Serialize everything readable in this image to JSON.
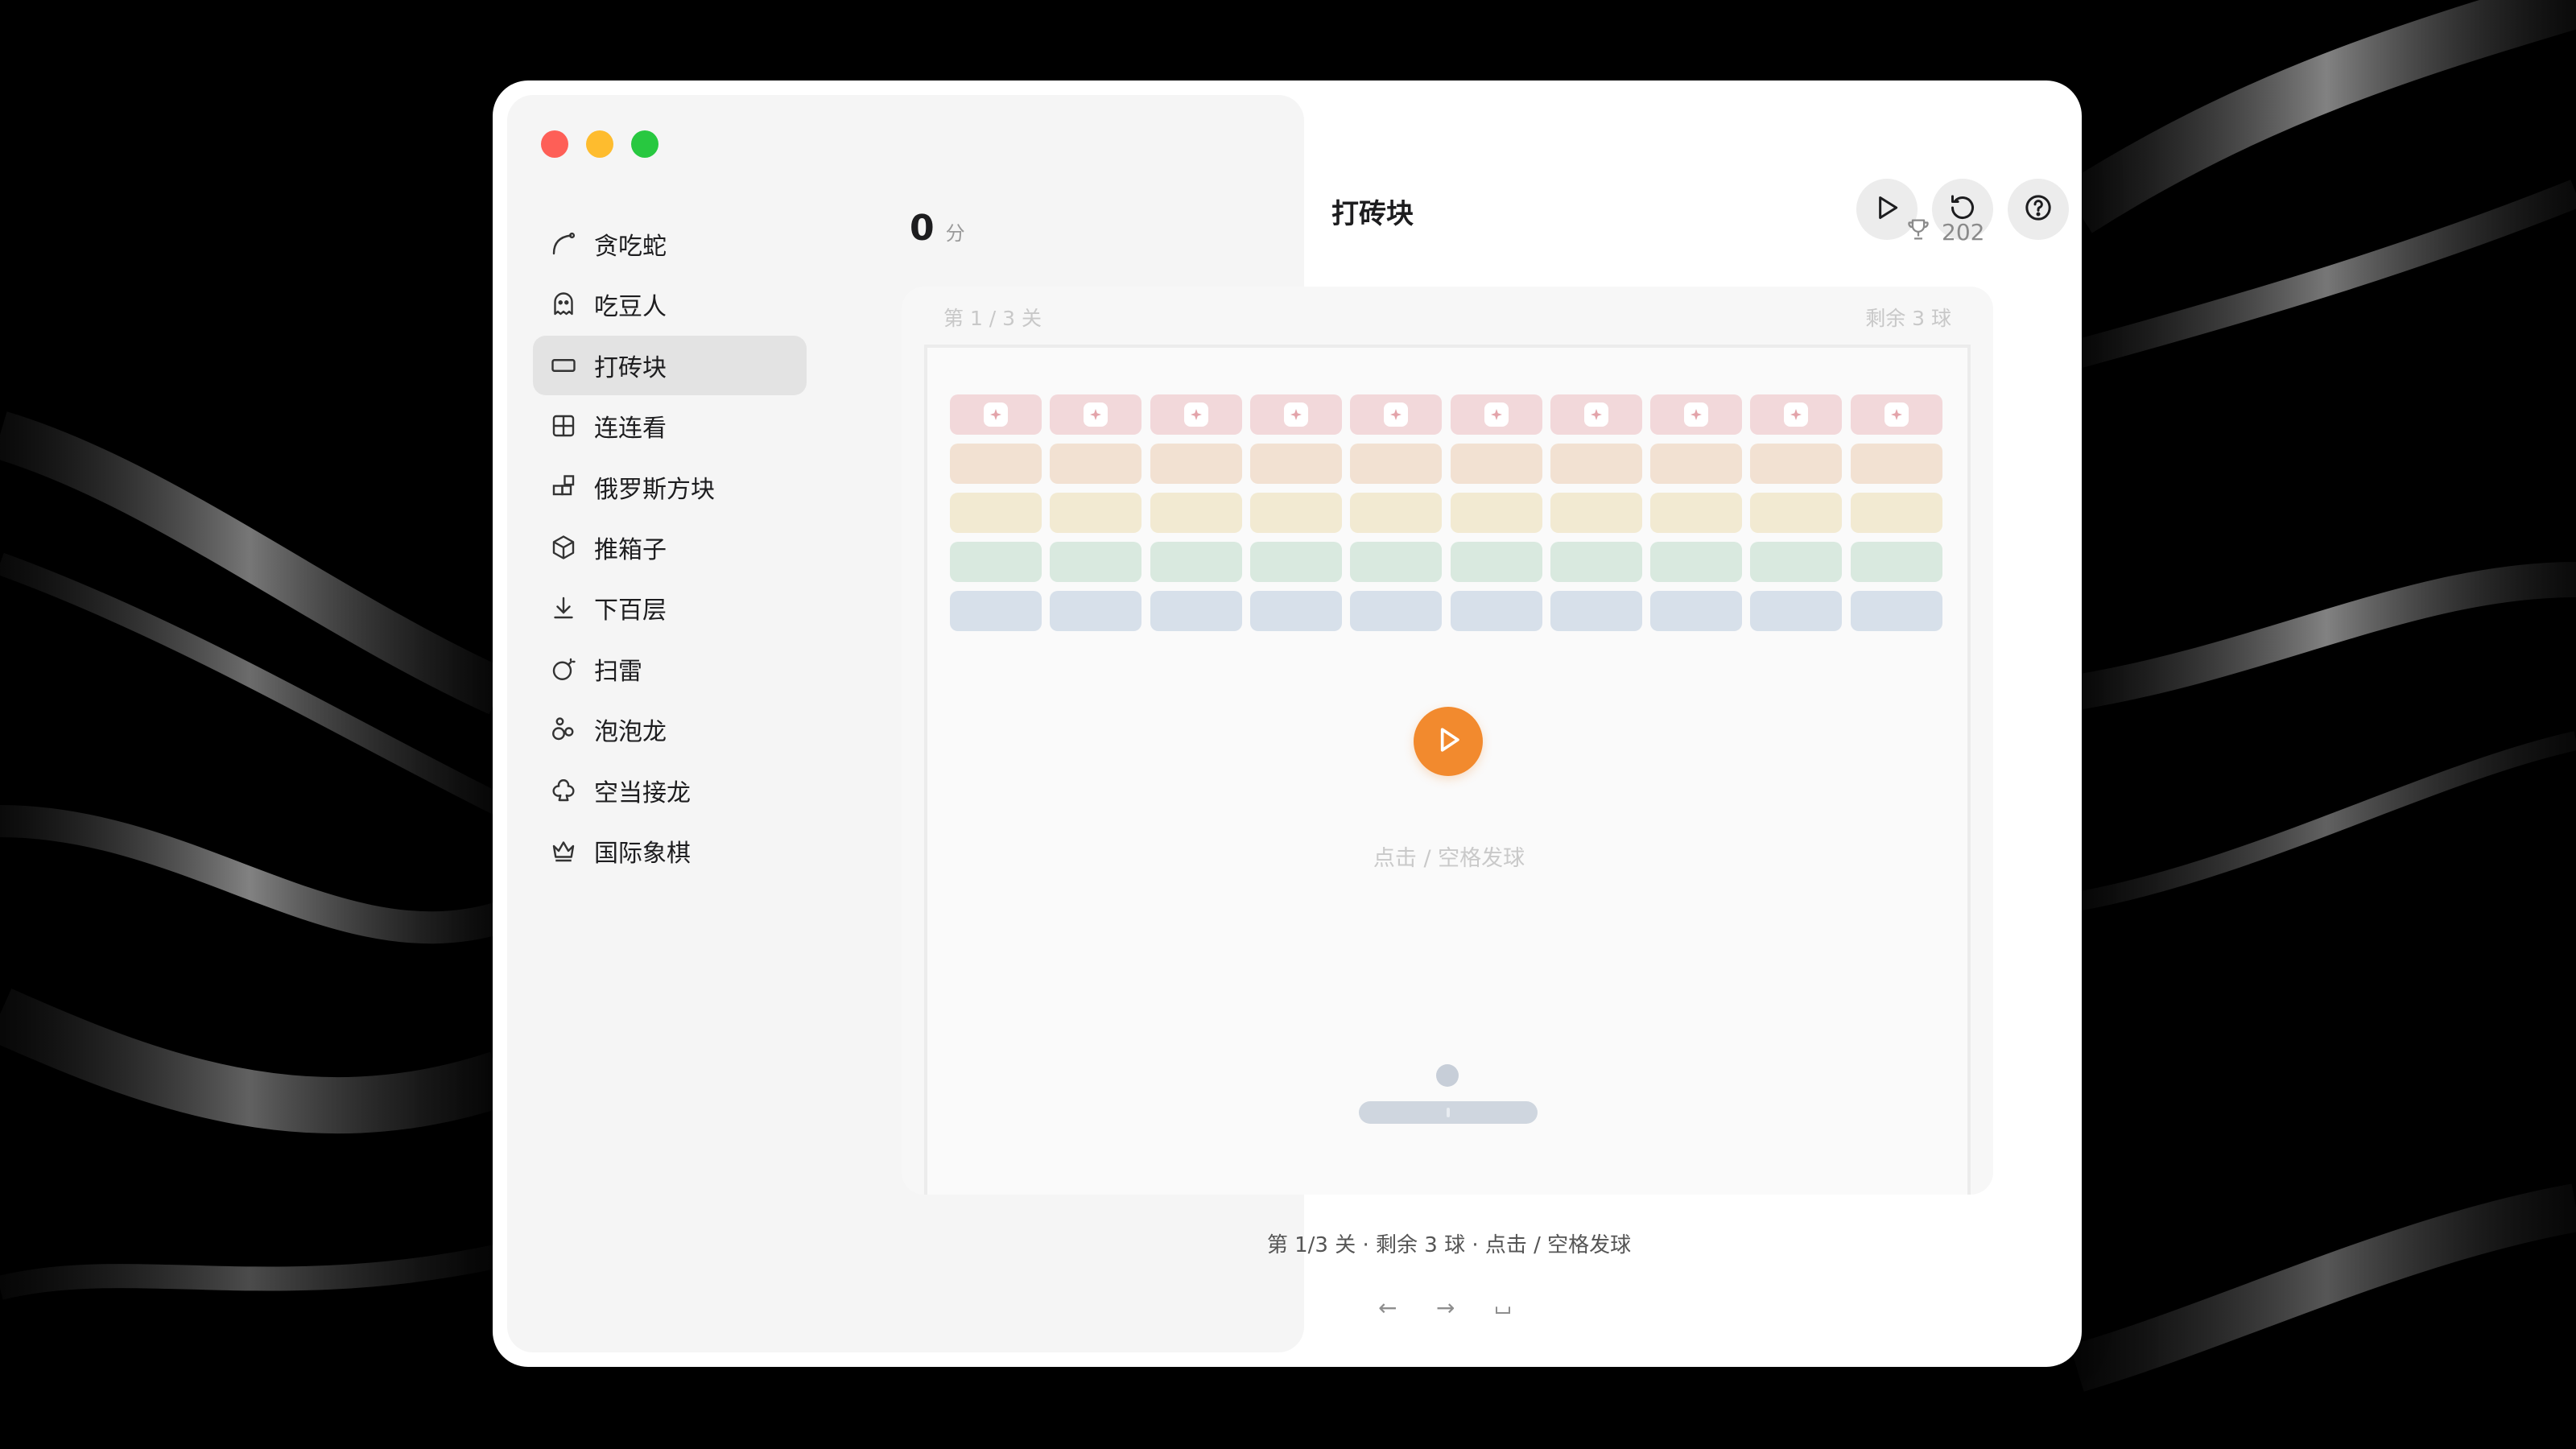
{
  "window": {
    "title": "打砖块"
  },
  "sidebar": {
    "items": [
      {
        "label": "贪吃蛇",
        "icon": "snake-curve-icon"
      },
      {
        "label": "吃豆人",
        "icon": "ghost-icon"
      },
      {
        "label": "打砖块",
        "icon": "brick-rect-icon",
        "active": true
      },
      {
        "label": "连连看",
        "icon": "grid-icon"
      },
      {
        "label": "俄罗斯方块",
        "icon": "blocks-icon"
      },
      {
        "label": "推箱子",
        "icon": "box-icon"
      },
      {
        "label": "下百层",
        "icon": "arrow-down-icon"
      },
      {
        "label": "扫雷",
        "icon": "bomb-icon"
      },
      {
        "label": "泡泡龙",
        "icon": "bubbles-icon"
      },
      {
        "label": "空当接龙",
        "icon": "club-icon"
      },
      {
        "label": "国际象棋",
        "icon": "crown-icon"
      }
    ]
  },
  "toolbar": {
    "play_icon": "play-icon",
    "restart_icon": "restart-icon",
    "help_icon": "help-icon"
  },
  "score": {
    "value": "0",
    "unit": "分",
    "best": "202",
    "best_icon": "trophy-icon"
  },
  "board": {
    "level_label": "第 1 / 3 关",
    "balls_label": "剩余 3 球",
    "hint": "点击 / 空格发球",
    "brick_columns": 10,
    "brick_rows": [
      {
        "color": "#f2d8da",
        "badge": true
      },
      {
        "color": "#f2e1d2"
      },
      {
        "color": "#f2ead2"
      },
      {
        "color": "#d9e9df"
      },
      {
        "color": "#d7e0ea"
      }
    ],
    "accent": "#f28a2e"
  },
  "status": {
    "text": "第 1/3 关 · 剩余 3 球 · 点击 / 空格发球"
  },
  "keys": {
    "left": "←",
    "right": "→",
    "space_icon": "space-key-icon"
  }
}
